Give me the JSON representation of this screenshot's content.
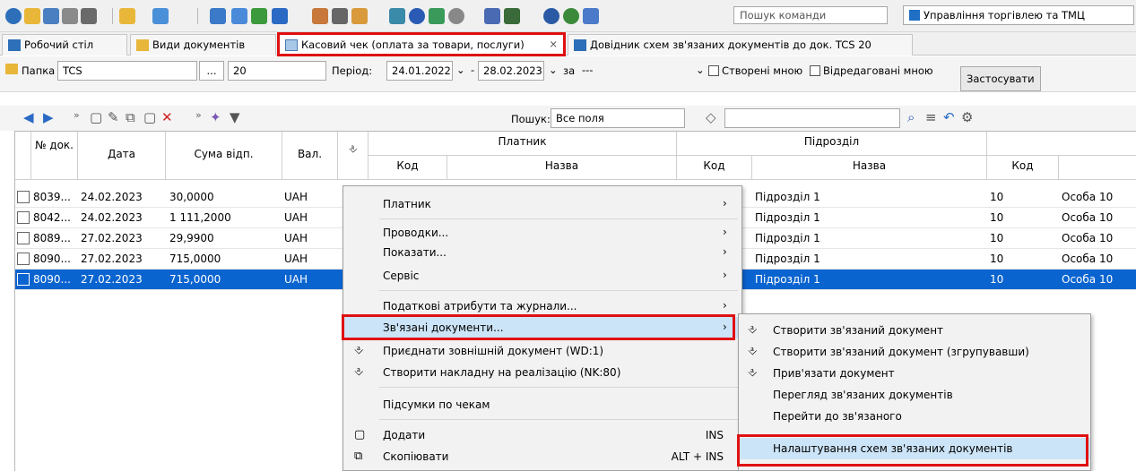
{
  "toolbar": {
    "command_search_placeholder": "Пошук команди",
    "module_label": "Управління торгівлею та ТМЦ"
  },
  "tabs": [
    {
      "label": "Робочий стіл"
    },
    {
      "label": "Види документів"
    },
    {
      "label": "Касовий чек (оплата за товари, послуги)"
    },
    {
      "label": "Довідник схем зв'язаних документів до док. TCS 20"
    }
  ],
  "filter": {
    "folder_label": "Папка",
    "folder_value": "TCS",
    "ellipsis": "...",
    "folder_number": "20",
    "period_label": "Період:",
    "date_from": "24.01.2022",
    "date_to": "28.02.2023",
    "za_label": "за",
    "za_value": "---",
    "created_by_me": "Створені мною",
    "edited_by_me": "Відредаговані мною",
    "apply": "Застосувати"
  },
  "grid_toolbar": {
    "search_label": "Пошук:",
    "search_scope": "Все поля"
  },
  "grid": {
    "headers": {
      "num": "№ док.",
      "date": "Дата",
      "sum": "Сума відп.",
      "cur": "Вал.",
      "payer": "Платник",
      "subdivision": "Підрозділ",
      "code": "Код",
      "name": "Назва"
    },
    "rows": [
      {
        "num": "8039...",
        "date": "24.02.2023",
        "sum": "30,0000",
        "cur": "UAH",
        "sub_name": "Підрозділ 1",
        "code2": "10",
        "person": "Особа 10"
      },
      {
        "num": "8042...",
        "date": "24.02.2023",
        "sum": "1 111,2000",
        "cur": "UAH",
        "sub_name": "Підрозділ 1",
        "code2": "10",
        "person": "Особа 10"
      },
      {
        "num": "8089...",
        "date": "27.02.2023",
        "sum": "29,9900",
        "cur": "UAH",
        "sub_name": "Підрозділ 1",
        "code2": "10",
        "person": "Особа 10"
      },
      {
        "num": "8090...",
        "date": "27.02.2023",
        "sum": "715,0000",
        "cur": "UAH",
        "sub_name": "Підрозділ 1",
        "code2": "10",
        "person": "Особа 10"
      },
      {
        "num": "8090...",
        "date": "27.02.2023",
        "sum": "715,0000",
        "cur": "UAH",
        "sub_name": "Підрозділ 1",
        "code2": "10",
        "person": "Особа 10"
      }
    ]
  },
  "context_menu": {
    "payer": "Платник",
    "postings": "Проводки...",
    "show": "Показати...",
    "service": "Сервіс",
    "tax": "Податкові атрибути та журнали...",
    "linked": "Зв'язані документи...",
    "attach_external": "Приєднати зовнішній документ (WD:1)",
    "create_invoice": "Створити накладну на реалізацію (NK:80)",
    "totals": "Підсумки по чекам",
    "add": "Додати",
    "add_shortcut": "INS",
    "copy": "Скопіювати",
    "copy_shortcut": "ALT + INS"
  },
  "submenu": {
    "create_linked": "Створити зв'язаний документ",
    "create_linked_grouped": "Створити зв'язаний документ (згрупувавши)",
    "bind_doc": "Прив'язати документ",
    "view_linked": "Перегляд зв'язаних документів",
    "goto_linked": "Перейти до зв'язаного",
    "settings": "Налаштування схем зв'язаних документів"
  },
  "colors": {
    "selection": "#0a64d0",
    "highlight": "#cce4f7",
    "annotation": "#e01010"
  }
}
